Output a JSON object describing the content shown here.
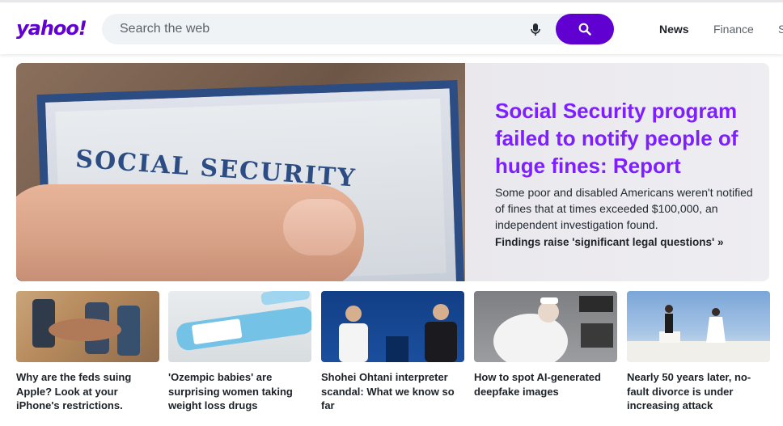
{
  "header": {
    "logo_text": "yahoo!",
    "search_placeholder": "Search the web",
    "nav": [
      "News",
      "Finance",
      "S"
    ]
  },
  "hero": {
    "image_card_text": "SOCIAL SECURITY",
    "title": "Social Security program failed to notify people of huge fines: Report",
    "summary": "Some poor and disabled Americans weren't notified of fines that at times exceeded $100,000, an independent investigation found.",
    "link": "Findings raise 'significant legal questions' »"
  },
  "stories": [
    {
      "title": "Why are the feds suing Apple? Look at your iPhone's restrictions."
    },
    {
      "title": "'Ozempic babies' are surprising women taking weight loss drugs"
    },
    {
      "title": "Shohei Ohtani interpreter scandal: What we know so far"
    },
    {
      "title": "How to spot AI-generated deepfake images"
    },
    {
      "title": "Nearly 50 years later, no-fault divorce is under increasing attack"
    }
  ],
  "colors": {
    "brand": "#6001d2",
    "hero_title": "#7e1fff"
  }
}
